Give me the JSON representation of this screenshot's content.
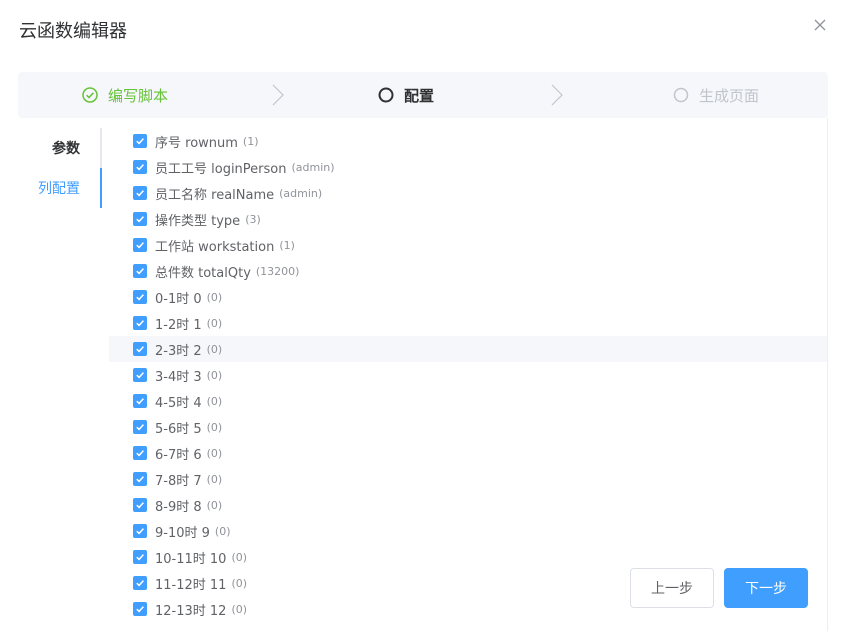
{
  "dialog": {
    "title": "云函数编辑器"
  },
  "steps": [
    {
      "label": "编写脚本",
      "status": "done"
    },
    {
      "label": "配置",
      "status": "active"
    },
    {
      "label": "生成页面",
      "status": "wait"
    }
  ],
  "tabs": [
    {
      "label": "参数",
      "active": false
    },
    {
      "label": "列配置",
      "active": true
    }
  ],
  "columns": [
    {
      "label": "序号 rownum",
      "count": "(1)",
      "checked": true
    },
    {
      "label": "员工工号 loginPerson",
      "count": "(admin)",
      "checked": true
    },
    {
      "label": "员工名称 realName",
      "count": "(admin)",
      "checked": true
    },
    {
      "label": "操作类型 type",
      "count": "(3)",
      "checked": true
    },
    {
      "label": "工作站 workstation",
      "count": "(1)",
      "checked": true
    },
    {
      "label": "总件数 totalQty",
      "count": "(13200)",
      "checked": true
    },
    {
      "label": "0-1时 0",
      "count": "(0)",
      "checked": true
    },
    {
      "label": "1-2时 1",
      "count": "(0)",
      "checked": true
    },
    {
      "label": "2-3时 2",
      "count": "(0)",
      "checked": true
    },
    {
      "label": "3-4时 3",
      "count": "(0)",
      "checked": true
    },
    {
      "label": "4-5时 4",
      "count": "(0)",
      "checked": true
    },
    {
      "label": "5-6时 5",
      "count": "(0)",
      "checked": true
    },
    {
      "label": "6-7时 6",
      "count": "(0)",
      "checked": true
    },
    {
      "label": "7-8时 7",
      "count": "(0)",
      "checked": true
    },
    {
      "label": "8-9时 8",
      "count": "(0)",
      "checked": true
    },
    {
      "label": "9-10时 9",
      "count": "(0)",
      "checked": true
    },
    {
      "label": "10-11时 10",
      "count": "(0)",
      "checked": true
    },
    {
      "label": "11-12时 11",
      "count": "(0)",
      "checked": true
    },
    {
      "label": "12-13时 12",
      "count": "(0)",
      "checked": true
    }
  ],
  "buttons": {
    "prev": "上一步",
    "next": "下一步"
  },
  "colors": {
    "primary": "#409eff",
    "success": "#67c23a",
    "muted": "#c0c4cc"
  }
}
